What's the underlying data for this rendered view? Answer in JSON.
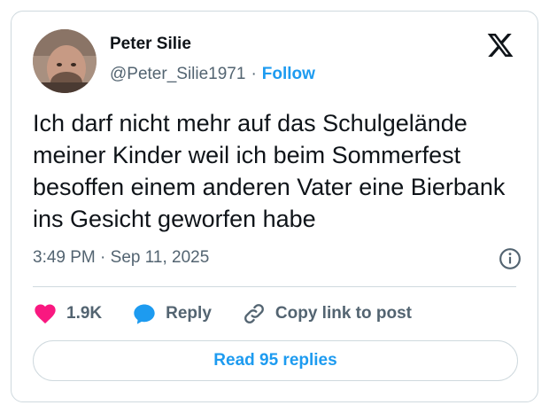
{
  "author": {
    "name": "Peter Silie",
    "handle": "@Peter_Silie1971",
    "separator": "·",
    "follow_label": "Follow"
  },
  "tweet": {
    "text": "Ich darf nicht mehr auf das Schulgelände meiner Kinder weil ich beim Sommerfest besoffen einem anderen Vater eine Bierbank ins Gesicht geworfen habe",
    "timestamp": "3:49 PM · Sep 11, 2025"
  },
  "actions": {
    "like_count": "1.9K",
    "reply_label": "Reply",
    "copy_link_label": "Copy link to post"
  },
  "read_replies_label": "Read 95 replies",
  "icons": {
    "brand": "x-logo-icon",
    "info": "info-icon",
    "like": "heart-icon",
    "reply": "speech-bubble-icon",
    "copy": "link-icon"
  },
  "colors": {
    "accent": "#1d9bf0",
    "heart": "#f91880",
    "text": "#0f1419",
    "secondary": "#536471",
    "border": "#cfd9de"
  }
}
